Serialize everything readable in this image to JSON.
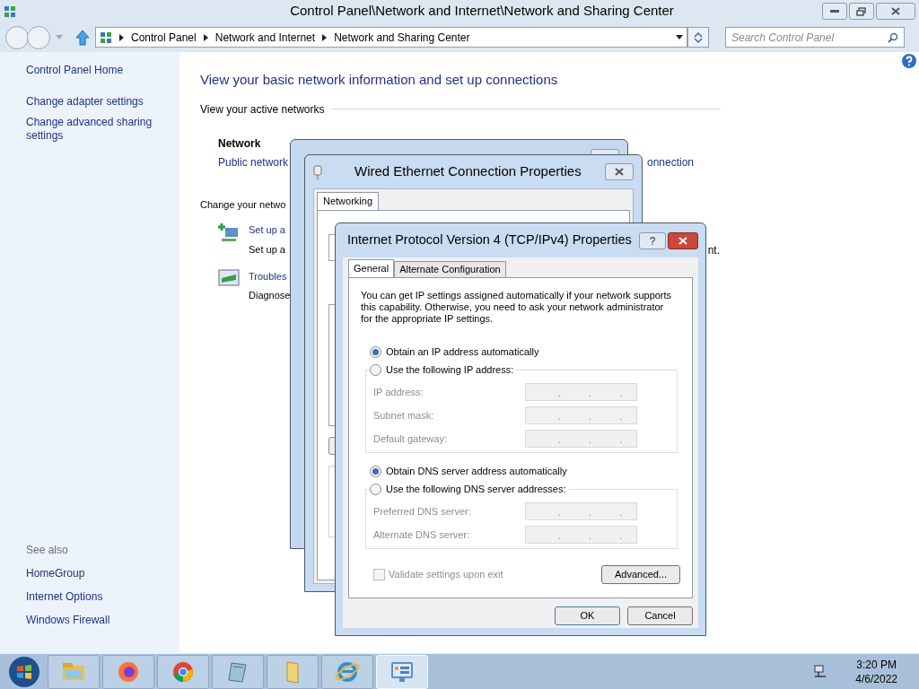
{
  "window": {
    "title": "Control Panel\\Network and Internet\\Network and Sharing Center"
  },
  "address_bar": {
    "crumbs": [
      "Control Panel",
      "Network and Internet",
      "Network and Sharing Center"
    ]
  },
  "search": {
    "placeholder": "Search Control Panel"
  },
  "sidebar": {
    "items": [
      "Control Panel Home",
      "Change adapter settings",
      "Change advanced sharing settings"
    ],
    "see_also_title": "See also",
    "see_also": [
      "HomeGroup",
      "Internet Options",
      "Windows Firewall"
    ]
  },
  "content": {
    "heading": "View your basic network information and set up connections",
    "active_networks_label": "View your active networks",
    "network_name": "Network",
    "network_type": "Public network",
    "connection_link": "onnection",
    "change_label": "Change your netwo",
    "tasks": [
      {
        "kind": "setup",
        "link": "Set up a",
        "description": "Set up a"
      },
      {
        "kind": "troubleshoot",
        "link": "Troubles",
        "description": "Diagnose"
      }
    ],
    "trailing_text": "nt."
  },
  "properties_dialog": {
    "title": "Wired Ethernet Connection Properties",
    "tabs": [
      {
        "label": "Networking",
        "selected": true
      }
    ]
  },
  "ipv4_dialog": {
    "title": "Internet Protocol Version 4 (TCP/IPv4) Properties",
    "help": "?",
    "tabs": [
      {
        "label": "General",
        "selected": true
      },
      {
        "label": "Alternate Configuration",
        "selected": false
      }
    ],
    "intro": "You can get IP settings assigned automatically if your network supports this capability. Otherwise, you need to ask your network administrator for the appropriate IP settings.",
    "ip_options": [
      {
        "label": "Obtain an IP address automatically",
        "selected": true
      },
      {
        "label": "Use the following IP address:",
        "selected": false
      }
    ],
    "ip_fields": [
      {
        "label": "IP address:",
        "separators": [
          ".",
          ".",
          "."
        ],
        "disabled": true
      },
      {
        "label": "Subnet mask:",
        "separators": [
          ".",
          ".",
          "."
        ],
        "disabled": true
      },
      {
        "label": "Default gateway:",
        "separators": [
          ".",
          ".",
          "."
        ],
        "disabled": true
      }
    ],
    "dns_options": [
      {
        "label": "Obtain DNS server address automatically",
        "selected": true
      },
      {
        "label": "Use the following DNS server addresses:",
        "selected": false
      }
    ],
    "dns_fields": [
      {
        "label": "Preferred DNS server:",
        "separators": [
          ".",
          ".",
          "."
        ],
        "disabled": true
      },
      {
        "label": "Alternate DNS server:",
        "separators": [
          ".",
          ".",
          "."
        ],
        "disabled": true
      }
    ],
    "validate": {
      "label": "Validate settings upon exit",
      "checked": false,
      "disabled": true
    },
    "advanced_button": "Advanced...",
    "buttons": [
      "OK",
      "Cancel"
    ]
  },
  "taskbar": {
    "apps": [
      {
        "kind": "explorer",
        "selected": false
      },
      {
        "kind": "firefox",
        "selected": false
      },
      {
        "kind": "chrome",
        "selected": false
      },
      {
        "kind": "notepad",
        "selected": false
      },
      {
        "kind": "folder",
        "selected": false
      },
      {
        "kind": "ie",
        "selected": false
      },
      {
        "kind": "control-panel",
        "selected": true
      }
    ],
    "time": "3:20 PM",
    "date": "4/6/2022"
  }
}
